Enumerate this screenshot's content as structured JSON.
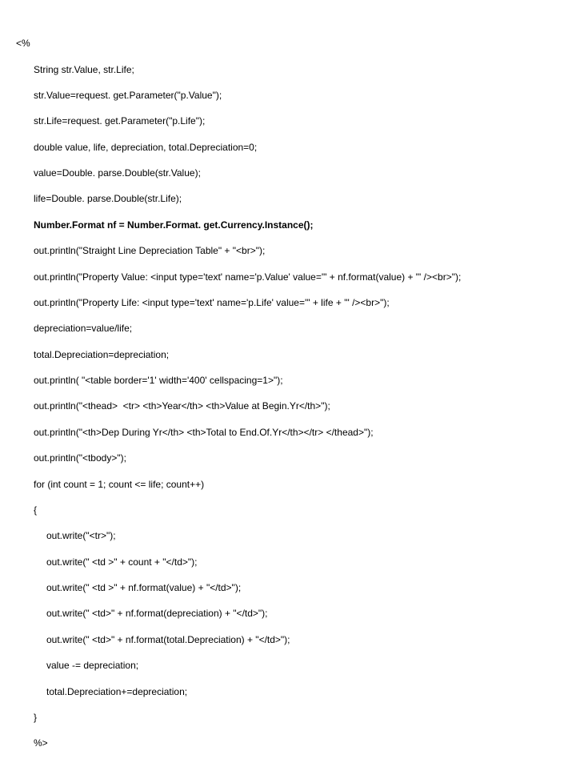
{
  "code": {
    "l0": "<%",
    "l1": "String str.Value, str.Life;",
    "l2": "str.Value=request. get.Parameter(\"p.Value\");",
    "l3": "str.Life=request. get.Parameter(\"p.Life\");",
    "l4": "double value, life, depreciation, total.Depreciation=0;",
    "l5": "value=Double. parse.Double(str.Value);",
    "l6": "life=Double. parse.Double(str.Life);",
    "l7": "Number.Format nf = Number.Format. get.Currency.Instance();",
    "l8": "out.println(\"Straight Line Depreciation Table\" + \"<br>\");",
    "l9": "out.println(\"Property Value: <input type='text' name='p.Value' value='\" + nf.format(value) + \"' /><br>\");",
    "l10": "out.println(\"Property Life: <input type='text' name='p.Life' value='\" + life + \"' /><br>\");",
    "l11": "depreciation=value/life;",
    "l12": "total.Depreciation=depreciation;",
    "l13": "out.println( \"<table border='1' width='400' cellspacing=1>\");",
    "l14": "out.println(\"<thead>  <tr> <th>Year</th> <th>Value at Begin.Yr</th>\");",
    "l15": "out.println(\"<th>Dep During Yr</th> <th>Total to End.Of.Yr</th></tr> </thead>\");",
    "l16": "out.println(\"<tbody>\");",
    "l17": "for (int count = 1; count <= life; count++)",
    "l18": "{",
    "l19": "out.write(\"<tr>\");",
    "l20": "out.write(\" <td >\" + count + \"</td>\");",
    "l21": "out.write(\" <td >\" + nf.format(value) + \"</td>\");",
    "l22": "out.write(\" <td>\" + nf.format(depreciation) + \"</td>\");",
    "l23": "out.write(\" <td>\" + nf.format(total.Depreciation) + \"</td>\");",
    "l24": "value -= depreciation;",
    "l25": "total.Depreciation+=depreciation;",
    "l26": "}",
    "l27": "%>"
  }
}
